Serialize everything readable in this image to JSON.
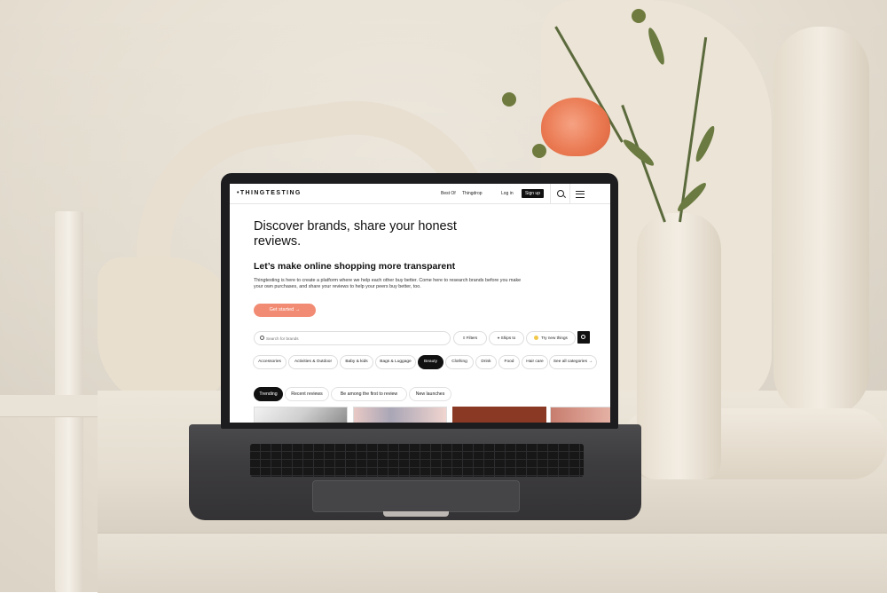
{
  "nav": {
    "logo": "•THINGTESTING",
    "links": [
      "Best Of",
      "Thingdrop"
    ],
    "login": "Log in",
    "signup": "Sign up"
  },
  "hero": {
    "headline": "Discover brands, share your honest reviews.",
    "subhead": "Let’s make online shopping more transparent",
    "description": "Thingtesting is here to create a platform where we help each other buy better. Come here to research brands before you make your own purchases, and share your reviews to help your peers buy better, too.",
    "cta": "Get started →"
  },
  "search": {
    "placeholder": "Search for brands",
    "filters": "Filters",
    "ships_to": "Ships to",
    "try_new": "Try new things"
  },
  "categories": [
    "Accessories",
    "Activities & Outdoor",
    "Baby & kids",
    "Bags & Luggage",
    "Beauty",
    "Clothing",
    "Drink",
    "Food",
    "Hair care",
    "See all categories →"
  ],
  "active_category": "Beauty",
  "tabs": [
    "Trending",
    "Recent reviews",
    "Be among the first to review",
    "New launches"
  ],
  "active_tab": "Trending",
  "colors": {
    "accent": "#f28b73",
    "dark": "#111111"
  },
  "icons": [
    "search-icon",
    "menu-icon",
    "filter-icon",
    "location-pin-icon",
    "smile-icon"
  ]
}
